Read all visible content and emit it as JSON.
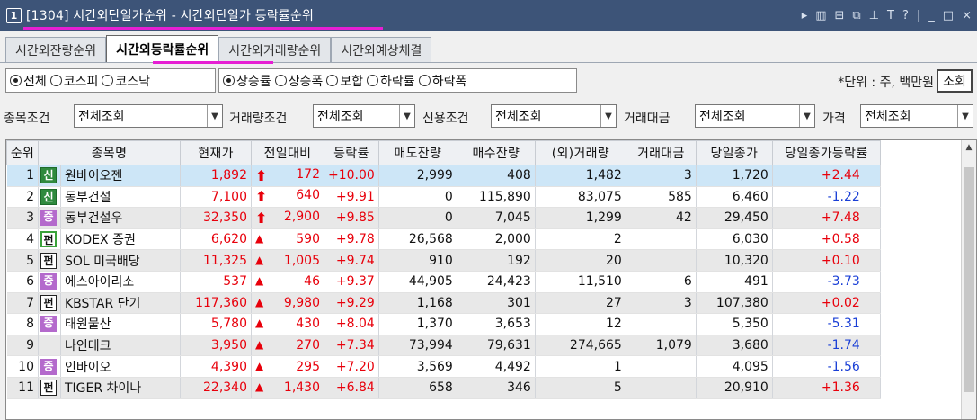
{
  "window": {
    "number": "1",
    "title": "[1304] 시간외단일가순위 - 시간외단일가 등락률순위",
    "controls": [
      "▸",
      "▥",
      "⊟",
      "⧉",
      "⊥",
      "T",
      "?",
      "|",
      "_",
      "□",
      "×"
    ]
  },
  "tabs": [
    {
      "label": "시간외잔량순위",
      "active": false
    },
    {
      "label": "시간외등락률순위",
      "active": true
    },
    {
      "label": "시간외거래량순위",
      "active": false
    },
    {
      "label": "시간외예상체결",
      "active": false
    }
  ],
  "market": {
    "options": [
      "전체",
      "코스피",
      "코스닥"
    ],
    "selected": "전체"
  },
  "direction": {
    "options": [
      "상승률",
      "상승폭",
      "보합",
      "하락률",
      "하락폭"
    ],
    "selected": "상승률"
  },
  "unit_text": "*단위 : 주, 백만원",
  "query_button": "조회",
  "conditions": [
    {
      "label": "종목조건",
      "value": "전체조회"
    },
    {
      "label": "거래량조건",
      "value": "전체조회"
    },
    {
      "label": "신용조건",
      "value": "전체조회"
    },
    {
      "label": "거래대금",
      "value": "전체조회"
    },
    {
      "label": "가격",
      "value": "전체조회"
    }
  ],
  "columns": [
    "순위",
    "종목명",
    "현재가",
    "전일대비",
    "등락률",
    "매도잔량",
    "매수잔량",
    "(외)거래량",
    "거래대금",
    "당일종가",
    "당일종가등락률"
  ],
  "rows": [
    {
      "rank": "1",
      "badge": "신",
      "name": "원바이오젠",
      "price": "1,892",
      "arrow": "up",
      "change": "172",
      "rate": "+10.00",
      "sell": "2,999",
      "buy": "408",
      "volume": "1,482",
      "amount": "3",
      "close": "1,720",
      "close_rate": "+2.44"
    },
    {
      "rank": "2",
      "badge": "신",
      "name": "동부건설",
      "price": "7,100",
      "arrow": "up",
      "change": "640",
      "rate": "+9.91",
      "sell": "0",
      "buy": "115,890",
      "volume": "83,075",
      "amount": "585",
      "close": "6,460",
      "close_rate": "-1.22"
    },
    {
      "rank": "3",
      "badge": "증",
      "name": "동부건설우",
      "price": "32,350",
      "arrow": "up",
      "change": "2,900",
      "rate": "+9.85",
      "sell": "0",
      "buy": "7,045",
      "volume": "1,299",
      "amount": "42",
      "close": "29,450",
      "close_rate": "+7.48"
    },
    {
      "rank": "4",
      "badge": "펀",
      "name": "KODEX 증권",
      "price": "6,620",
      "arrow": "tri",
      "change": "590",
      "rate": "+9.78",
      "sell": "26,568",
      "buy": "2,000",
      "volume": "2",
      "amount": "",
      "close": "6,030",
      "close_rate": "+0.58"
    },
    {
      "rank": "5",
      "badge": "펀",
      "name": "SOL 미국배당",
      "price": "11,325",
      "arrow": "tri",
      "change": "1,005",
      "rate": "+9.74",
      "sell": "910",
      "buy": "192",
      "volume": "20",
      "amount": "",
      "close": "10,320",
      "close_rate": "+0.10"
    },
    {
      "rank": "6",
      "badge": "증",
      "name": "에스아이리소",
      "price": "537",
      "arrow": "tri",
      "change": "46",
      "rate": "+9.37",
      "sell": "44,905",
      "buy": "24,423",
      "volume": "11,510",
      "amount": "6",
      "close": "491",
      "close_rate": "-3.73"
    },
    {
      "rank": "7",
      "badge": "펀",
      "name": "KBSTAR 단기",
      "price": "117,360",
      "arrow": "tri",
      "change": "9,980",
      "rate": "+9.29",
      "sell": "1,168",
      "buy": "301",
      "volume": "27",
      "amount": "3",
      "close": "107,380",
      "close_rate": "+0.02"
    },
    {
      "rank": "8",
      "badge": "증",
      "name": "태원물산",
      "price": "5,780",
      "arrow": "tri",
      "change": "430",
      "rate": "+8.04",
      "sell": "1,370",
      "buy": "3,653",
      "volume": "12",
      "amount": "",
      "close": "5,350",
      "close_rate": "-5.31"
    },
    {
      "rank": "9",
      "badge": "",
      "name": "나인테크",
      "price": "3,950",
      "arrow": "tri",
      "change": "270",
      "rate": "+7.34",
      "sell": "73,994",
      "buy": "79,631",
      "volume": "274,665",
      "amount": "1,079",
      "close": "3,680",
      "close_rate": "-1.74"
    },
    {
      "rank": "10",
      "badge": "증",
      "name": "인바이오",
      "price": "4,390",
      "arrow": "tri",
      "change": "295",
      "rate": "+7.20",
      "sell": "3,569",
      "buy": "4,492",
      "volume": "1",
      "amount": "",
      "close": "4,095",
      "close_rate": "-1.56"
    },
    {
      "rank": "11",
      "badge": "펀",
      "name": "TIGER 차이나",
      "price": "22,340",
      "arrow": "tri",
      "change": "1,430",
      "rate": "+6.84",
      "sell": "658",
      "buy": "346",
      "volume": "5",
      "amount": "",
      "close": "20,910",
      "close_rate": "+1.36"
    }
  ]
}
